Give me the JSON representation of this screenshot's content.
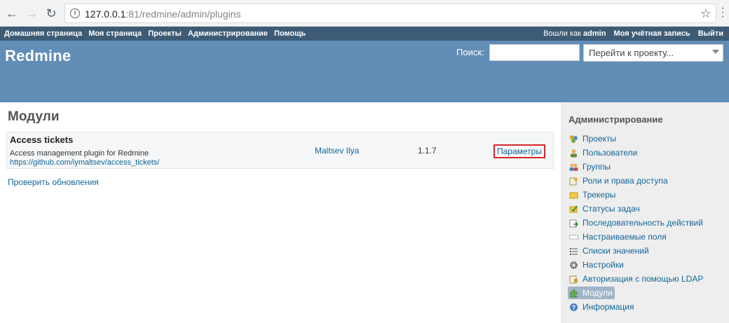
{
  "browser": {
    "url_host": "127.0.0.1",
    "url_rest": ":81/redmine/admin/plugins"
  },
  "top_menu": {
    "items": [
      "Домашняя страница",
      "Моя страница",
      "Проекты",
      "Администрирование",
      "Помощь"
    ],
    "logged_as_label": "Вошли как",
    "logged_as_user": "admin",
    "my_account": "Моя учётная запись",
    "logout": "Выйти"
  },
  "header": {
    "title": "Redmine",
    "search_label": "Поиск:",
    "search_value": "",
    "jump_placeholder": "Перейти к проекту..."
  },
  "main": {
    "title": "Модули",
    "plugin": {
      "name": "Access tickets",
      "description": "Access management plugin for Redmine",
      "url": "https://github.com/iymaltsev/access_tickets/",
      "author": "Maltsev Ilya",
      "version": "1.1.7",
      "configure": "Параметры"
    },
    "check_updates": "Проверить обновления"
  },
  "sidebar": {
    "title": "Администрирование",
    "items": [
      {
        "label": "Проекты",
        "icon": "projects-icon"
      },
      {
        "label": "Пользователи",
        "icon": "user-icon"
      },
      {
        "label": "Группы",
        "icon": "group-icon"
      },
      {
        "label": "Роли и права доступа",
        "icon": "roles-icon"
      },
      {
        "label": "Трекеры",
        "icon": "tracker-icon"
      },
      {
        "label": "Статусы задач",
        "icon": "issue-status-icon"
      },
      {
        "label": "Последовательность действий",
        "icon": "workflow-icon"
      },
      {
        "label": "Настраиваемые поля",
        "icon": "custom-fields-icon"
      },
      {
        "label": "Списки значений",
        "icon": "list-icon"
      },
      {
        "label": "Настройки",
        "icon": "gear-icon"
      },
      {
        "label": "Авторизация с помощью LDAP",
        "icon": "ldap-icon"
      },
      {
        "label": "Модули",
        "icon": "plugin-icon",
        "selected": true
      },
      {
        "label": "Информация",
        "icon": "info-icon"
      }
    ]
  },
  "colors": {
    "top_menu_bg": "#3e5b76",
    "header_bg": "#628db6",
    "link": "#116699",
    "sidebar_bg": "#eeeeee",
    "highlight_box": "#d3272f",
    "selected_item_bg": "#9fb5c8"
  }
}
